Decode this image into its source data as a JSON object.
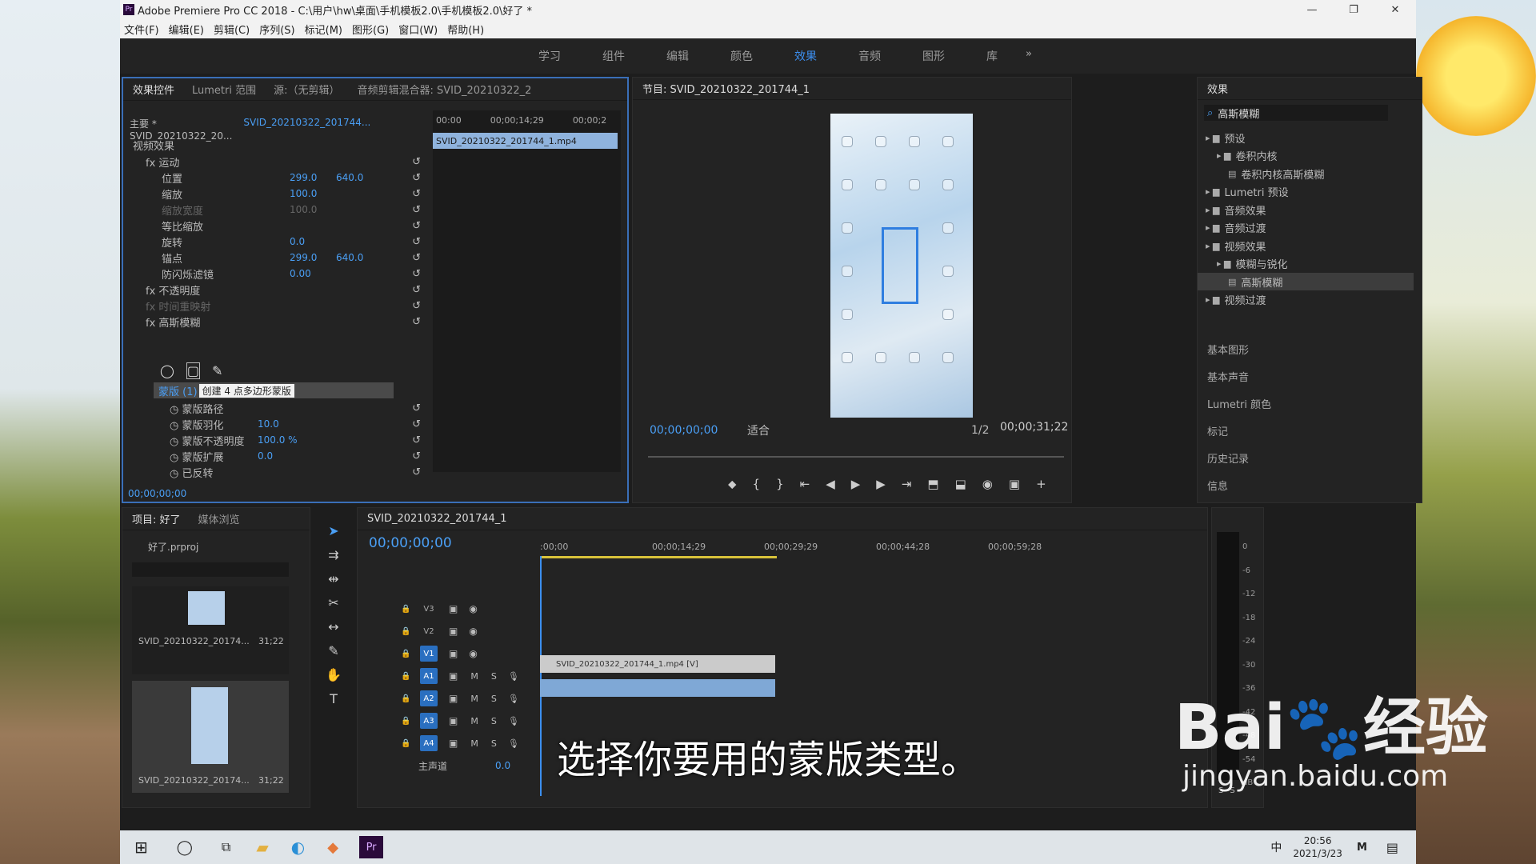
{
  "window": {
    "title": "Adobe Premiere Pro CC 2018 - C:\\用户\\hw\\桌面\\手机模板2.0\\手机模板2.0\\好了 *",
    "app_badge": "Pr",
    "controls": [
      "—",
      "❐",
      "✕"
    ]
  },
  "menu": [
    "文件(F)",
    "编辑(E)",
    "剪辑(C)",
    "序列(S)",
    "标记(M)",
    "图形(G)",
    "窗口(W)",
    "帮助(H)"
  ],
  "workspaces": {
    "items": [
      "学习",
      "组件",
      "编辑",
      "颜色",
      "效果",
      "音频",
      "图形",
      "库"
    ],
    "active": "效果",
    "more": "»"
  },
  "effect_controls": {
    "tabs": [
      "效果控件",
      "Lumetri 范围",
      "源:（无剪辑）",
      "音频剪辑混合器: SVID_20210322_2"
    ],
    "master": "主要 * SVID_20210322_20...",
    "clip": "SVID_20210322_201744...",
    "ruler": [
      "00:00",
      "00;00;14;29",
      "00;00;2"
    ],
    "clip_bar": "SVID_20210322_201744_1.mp4",
    "video_effects_label": "视频效果",
    "rows": [
      {
        "label": "运动",
        "fx": true,
        "v1": "",
        "v2": ""
      },
      {
        "label": "位置",
        "v1": "299.0",
        "v2": "640.0"
      },
      {
        "label": "缩放",
        "v1": "100.0",
        "v2": ""
      },
      {
        "label": "缩放宽度",
        "v1": "100.0",
        "v2": "",
        "disabled": true
      },
      {
        "label": "等比缩放",
        "v1": "",
        "v2": "",
        "checkbox": true
      },
      {
        "label": "旋转",
        "v1": "0.0",
        "v2": ""
      },
      {
        "label": "锚点",
        "v1": "299.0",
        "v2": "640.0"
      },
      {
        "label": "防闪烁滤镜",
        "v1": "0.00",
        "v2": ""
      },
      {
        "label": "不透明度",
        "fx": true,
        "v1": "",
        "v2": ""
      },
      {
        "label": "时间重映射",
        "fx": true,
        "v1": "",
        "v2": "",
        "disabled": true
      },
      {
        "label": "高斯模糊",
        "fx": true,
        "v1": "",
        "v2": ""
      }
    ],
    "mask_label": "蒙版 (1)",
    "mask_tooltip": "创建 4 点多边形蒙版",
    "mask_rows": [
      {
        "label": "蒙版路径",
        "v1": ""
      },
      {
        "label": "蒙版羽化",
        "v1": "10.0"
      },
      {
        "label": "蒙版不透明度",
        "v1": "100.0 %"
      },
      {
        "label": "蒙版扩展",
        "v1": "0.0"
      },
      {
        "label": "已反转",
        "v1": ""
      }
    ],
    "timecode": "00;00;00;00"
  },
  "program_monitor": {
    "title": "节目: SVID_20210322_201744_1",
    "timecode": "00;00;00;00",
    "fit": "适合",
    "quality": "1/2",
    "duration": "00;00;31;22"
  },
  "effects_panel": {
    "title": "效果",
    "search": "高斯模糊",
    "tree": [
      {
        "label": "预设",
        "level": 0
      },
      {
        "label": "卷积内核",
        "level": 1
      },
      {
        "label": "卷积内核高斯模糊",
        "level": 2
      },
      {
        "label": "Lumetri 预设",
        "level": 0
      },
      {
        "label": "音频效果",
        "level": 0
      },
      {
        "label": "音频过渡",
        "level": 0
      },
      {
        "label": "视频效果",
        "level": 0
      },
      {
        "label": "模糊与锐化",
        "level": 1
      },
      {
        "label": "高斯模糊",
        "level": 2,
        "selected": true
      },
      {
        "label": "视频过渡",
        "level": 0
      }
    ],
    "sections": [
      "基本图形",
      "基本声音",
      "Lumetri 颜色",
      "标记",
      "历史记录",
      "信息"
    ]
  },
  "project_panel": {
    "tabs": [
      "项目: 好了",
      "媒体浏览"
    ],
    "file": "好了.prproj",
    "items": [
      {
        "name": "SVID_20210322_20174...",
        "duration": "31;22"
      },
      {
        "name": "SVID_20210322_20174...",
        "duration": "31;22"
      }
    ]
  },
  "timeline": {
    "title": "SVID_20210322_201744_1",
    "timecode": "00;00;00;00",
    "ruler": [
      ":00;00",
      "00;00;14;29",
      "00;00;29;29",
      "00;00;44;28",
      "00;00;59;28"
    ],
    "video_tracks": [
      "V3",
      "V2",
      "V1"
    ],
    "audio_tracks": [
      "A1",
      "A2",
      "A3",
      "A4"
    ],
    "master": {
      "label": "主声道",
      "value": "0.0"
    },
    "video_clip": "SVID_20210322_201744_1.mp4 [V]",
    "clip_end_fraction": 0.46
  },
  "meter": {
    "scale": [
      "0",
      "-6",
      "-12",
      "-18",
      "-24",
      "-30",
      "-36",
      "-42",
      "-48",
      "-54",
      "dB"
    ],
    "solo": [
      "S",
      "S"
    ]
  },
  "taskbar": {
    "time": "20:56",
    "date": "2021/3/23",
    "ime": "中",
    "ime2": "M"
  },
  "caption": "选择你要用的蒙版类型。",
  "watermark": {
    "brand": "Bai",
    "brand2": "经验",
    "url": "jingyan.baidu.com"
  },
  "colors": {
    "accent": "#3c8ff0",
    "value_blue": "#4a9ff5",
    "track_badge": "#2a6fc0"
  }
}
